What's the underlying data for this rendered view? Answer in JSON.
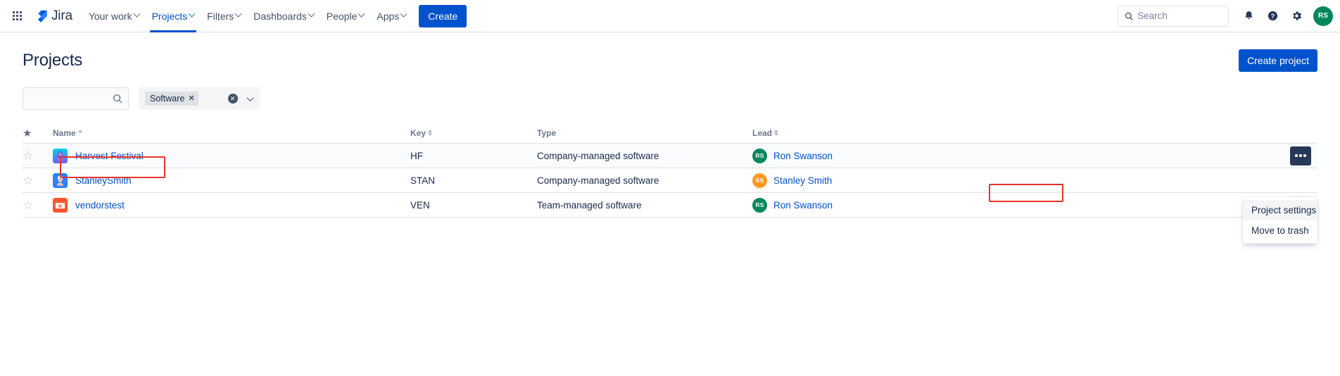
{
  "topnav": {
    "app_switcher_icon": "grid-apps-icon",
    "logo_text": "Jira",
    "items": [
      {
        "label": "Your work",
        "has_chevron": true,
        "active": false
      },
      {
        "label": "Projects",
        "has_chevron": true,
        "active": true
      },
      {
        "label": "Filters",
        "has_chevron": true,
        "active": false
      },
      {
        "label": "Dashboards",
        "has_chevron": true,
        "active": false
      },
      {
        "label": "People",
        "has_chevron": true,
        "active": false
      },
      {
        "label": "Apps",
        "has_chevron": true,
        "active": false
      }
    ],
    "create_label": "Create",
    "search": {
      "placeholder": "Search",
      "value": "",
      "icon": "search-icon"
    },
    "icons": [
      {
        "name": "notifications-bell-icon"
      },
      {
        "name": "help-question-icon"
      },
      {
        "name": "settings-gear-icon"
      }
    ],
    "avatar": {
      "initials": "RS",
      "color": "#00875a"
    }
  },
  "page": {
    "title": "Projects",
    "create_project_label": "Create project"
  },
  "filters": {
    "search": {
      "placeholder": "",
      "value": "",
      "icon": "search-icon"
    },
    "type_filter": {
      "chip_label": "Software",
      "chip_remove_icon": "close-x-icon",
      "clear_icon": "clear-circle-icon",
      "chevron_icon": "chevron-down-icon"
    }
  },
  "table": {
    "columns": [
      {
        "key": "star",
        "label": "",
        "icon": "star-icon",
        "sortable": false
      },
      {
        "key": "name",
        "label": "Name",
        "sortable": true,
        "sort": "asc"
      },
      {
        "key": "key",
        "label": "Key",
        "sortable": true,
        "sort": "none"
      },
      {
        "key": "type",
        "label": "Type",
        "sortable": false
      },
      {
        "key": "lead",
        "label": "Lead",
        "sortable": true,
        "sort": "none"
      }
    ],
    "rows": [
      {
        "starred": false,
        "star_icon": "star-outline-icon",
        "name": "Harvest Festival",
        "icon_name": "project-avatar-rocket",
        "icon_colors": [
          "#00c7e6",
          "#6554c0"
        ],
        "key": "HF",
        "type": "Company-managed software",
        "lead": {
          "name": "Ron Swanson",
          "initials": "RS",
          "color": "#00875a"
        },
        "more_icon": "more-actions-icon",
        "more_style": "dark"
      },
      {
        "starred": false,
        "star_icon": "star-outline-icon",
        "name": "StanleySmith",
        "icon_name": "project-avatar-person",
        "icon_colors": [
          "#2684ff",
          "#ffbdad"
        ],
        "key": "STAN",
        "type": "Company-managed software",
        "lead": {
          "name": "Stanley Smith",
          "initials": "SS",
          "color": "#ff991f"
        },
        "more_icon": "more-actions-icon",
        "more_style": "none"
      },
      {
        "starred": false,
        "star_icon": "star-outline-icon",
        "name": "vendorstest",
        "icon_name": "project-avatar-camera",
        "icon_colors": [
          "#ff5630",
          "#ffffff"
        ],
        "key": "VEN",
        "type": "Team-managed software",
        "lead": {
          "name": "Ron Swanson",
          "initials": "RS",
          "color": "#00875a"
        },
        "more_icon": "more-actions-icon",
        "more_style": "ghost"
      }
    ]
  },
  "context_menu": {
    "items": [
      {
        "label": "Project settings",
        "highlighted": true
      },
      {
        "label": "Move to trash",
        "highlighted": false
      }
    ]
  },
  "annotations": {
    "accent_color": "#e8332a",
    "boxes": [
      {
        "target": "project-link-harvest-festival"
      },
      {
        "target": "menu-item-project-settings"
      }
    ]
  }
}
